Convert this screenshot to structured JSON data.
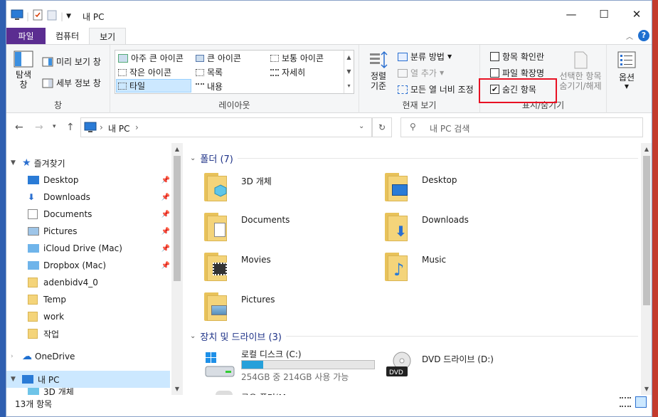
{
  "title": "내 PC",
  "window_controls": {
    "minimize": "—",
    "maximize": "☐",
    "close": "✕"
  },
  "tabs": [
    "파일",
    "컴퓨터",
    "보기"
  ],
  "ribbon": {
    "pane": {
      "nav_pane": "탐색\n창",
      "preview": "미리 보기 창",
      "details": "세부 정보 창",
      "group": "창"
    },
    "layout": {
      "items": [
        "아주 큰 아이콘",
        "큰 아이콘",
        "보통 아이콘",
        "작은 아이콘",
        "목록",
        "자세히",
        "타일",
        "내용"
      ],
      "group": "레이아웃"
    },
    "current_view": {
      "sort": "정렬\n기준",
      "group_by": "분류 방법",
      "add_column": "열 추가",
      "fit_columns": "모든 열 너비 조정",
      "group": "현재 보기"
    },
    "show_hide": {
      "item_checkboxes": "항목 확인란",
      "file_extensions": "파일 확장명",
      "hidden_items": "숨긴 항목",
      "hide_selected": "선택한 항목\n숨기기/해제",
      "group": "표시/숨기기",
      "hidden_checked": true
    },
    "options": "옵션"
  },
  "address": {
    "path": "내 PC",
    "search_placeholder": "내 PC 검색"
  },
  "nav": {
    "quick_access": "즐겨찾기",
    "items": [
      "Desktop",
      "Downloads",
      "Documents",
      "Pictures",
      "iCloud Drive (Mac)",
      "Dropbox (Mac)",
      "adenbidv4_0",
      "Temp",
      "work",
      "작업"
    ],
    "onedrive": "OneDrive",
    "this_pc": "내 PC",
    "sub_partial": "3D 개체"
  },
  "folders_header": "폴더 (7)",
  "folders": [
    "3D 개체",
    "Desktop",
    "Documents",
    "Downloads",
    "Movies",
    "Music",
    "Pictures"
  ],
  "drives_header": "장치 및 드라이브 (3)",
  "drives": [
    {
      "name": "로컬 디스크 (C:)",
      "info": "254GB 중 214GB 사용 가능",
      "fill": 0.16
    },
    {
      "name": "DVD 드라이브 (D:)"
    }
  ],
  "drive_partial": "공유 폴더(M...",
  "status": {
    "count": "13개 항목"
  },
  "colors": {
    "file_tab": "#5b2d91",
    "highlight_box": "#e81123",
    "selected_nav": "#cce8ff"
  }
}
